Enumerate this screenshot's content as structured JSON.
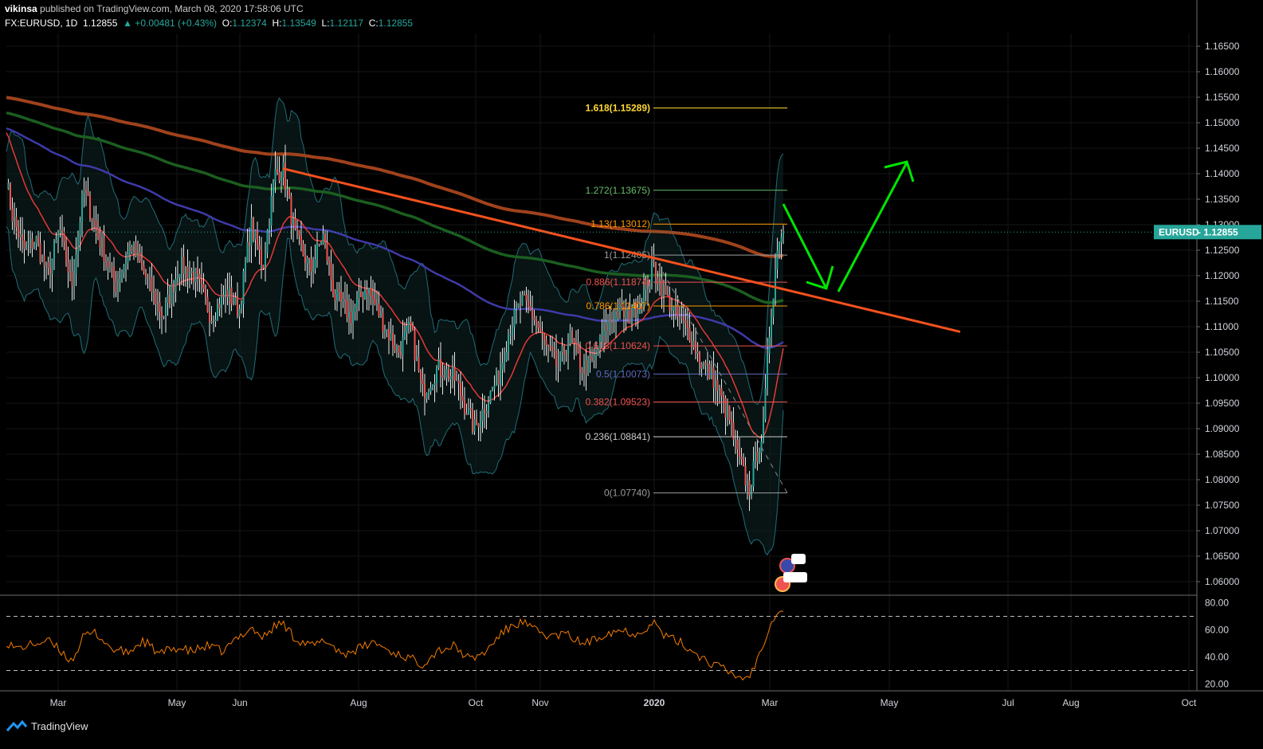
{
  "header": {
    "published_line": {
      "author": "vikinsa",
      "rest": " published on TradingView.com, March 08, 2020 17:58:06 UTC"
    },
    "symbol": "FX:EURUSD, 1D",
    "last": "1.12855",
    "change": "▲ +0.00481 (+0.43%)",
    "open_label": "O:",
    "open": "1.12374",
    "high_label": "H:",
    "high": "1.13549",
    "low_label": "L:",
    "low": "1.12117",
    "close_label": "C:",
    "close": "1.12855"
  },
  "price_tag": {
    "symbol": "EURUSD",
    "value": "1.12855"
  },
  "footer": {
    "brand": "TradingView"
  },
  "colors": {
    "background": "#000000",
    "up_candle": "#26a69a",
    "down_candle": "#ef5350",
    "trendline": "#f4511e",
    "arrow": "#00e600",
    "ema_red": "#e53935",
    "ema_brown": "#a0421c",
    "ema_green": "#1b5e20",
    "ema_blue": "#3f3aa8",
    "bollinger": "#1f6d78",
    "rsi": "#f57c00"
  },
  "chart_data": {
    "type": "candlestick",
    "y_range": [
      1.0575,
      1.1675
    ],
    "y_ticks": [
      "1.06000",
      "1.06500",
      "1.07000",
      "1.07500",
      "1.08000",
      "1.08500",
      "1.09000",
      "1.09500",
      "1.10000",
      "1.10500",
      "1.11000",
      "1.11500",
      "1.12000",
      "1.12500",
      "1.13000",
      "1.13500",
      "1.14000",
      "1.14500",
      "1.15000",
      "1.15500",
      "1.16000",
      "1.16500"
    ],
    "x_ticks": [
      "Mar",
      "May",
      "Jun",
      "Aug",
      "Oct",
      "Nov",
      "2020",
      "Mar",
      "May",
      "Jul",
      "Aug",
      "Oct"
    ],
    "price_path_knots": [
      [
        0,
        1.147
      ],
      [
        15,
        1.132
      ],
      [
        30,
        1.125
      ],
      [
        45,
        1.127
      ],
      [
        60,
        1.12
      ],
      [
        75,
        1.129
      ],
      [
        90,
        1.118
      ],
      [
        105,
        1.137
      ],
      [
        125,
        1.127
      ],
      [
        145,
        1.118
      ],
      [
        165,
        1.126
      ],
      [
        185,
        1.119
      ],
      [
        205,
        1.112
      ],
      [
        225,
        1.122
      ],
      [
        245,
        1.12
      ],
      [
        265,
        1.112
      ],
      [
        285,
        1.117
      ],
      [
        300,
        1.113
      ],
      [
        315,
        1.13
      ],
      [
        330,
        1.122
      ],
      [
        345,
        1.14
      ],
      [
        355,
        1.141
      ],
      [
        370,
        1.128
      ],
      [
        390,
        1.121
      ],
      [
        405,
        1.128
      ],
      [
        420,
        1.116
      ],
      [
        440,
        1.112
      ],
      [
        460,
        1.118
      ],
      [
        480,
        1.111
      ],
      [
        500,
        1.105
      ],
      [
        515,
        1.11
      ],
      [
        530,
        1.097
      ],
      [
        550,
        1.102
      ],
      [
        570,
        1.1
      ],
      [
        595,
        1.09
      ],
      [
        610,
        1.095
      ],
      [
        625,
        1.1
      ],
      [
        640,
        1.11
      ],
      [
        655,
        1.115
      ],
      [
        670,
        1.112
      ],
      [
        685,
        1.106
      ],
      [
        700,
        1.102
      ],
      [
        715,
        1.108
      ],
      [
        730,
        1.102
      ],
      [
        745,
        1.103
      ],
      [
        760,
        1.11
      ],
      [
        775,
        1.113
      ],
      [
        790,
        1.112
      ],
      [
        805,
        1.115
      ],
      [
        820,
        1.122
      ],
      [
        835,
        1.116
      ],
      [
        850,
        1.112
      ],
      [
        865,
        1.109
      ],
      [
        880,
        1.103
      ],
      [
        895,
        1.1
      ],
      [
        905,
        1.096
      ],
      [
        915,
        1.092
      ],
      [
        925,
        1.085
      ],
      [
        940,
        1.078
      ],
      [
        950,
        1.085
      ],
      [
        958,
        1.09
      ],
      [
        965,
        1.108
      ],
      [
        972,
        1.12
      ],
      [
        978,
        1.128
      ],
      [
        983,
        1.1285
      ]
    ],
    "trendline": {
      "from": [
        355,
        1.141
      ],
      "to": [
        1205,
        1.109
      ]
    },
    "fibonacci": [
      {
        "ratio": "0",
        "price": "1.07740",
        "label": "0(1.07740)"
      },
      {
        "ratio": "0.236",
        "price": "1.08841",
        "label": "0.236(1.08841)"
      },
      {
        "ratio": "0.382",
        "price": "1.09523",
        "label": "0.382(1.09523)"
      },
      {
        "ratio": "0.5",
        "price": "1.10073",
        "label": "0.5(1.10073)"
      },
      {
        "ratio": "0.618",
        "price": "1.10624",
        "label": "0.618(1.10624)"
      },
      {
        "ratio": "0.786",
        "price": "1.11407",
        "label": "0.786(1.11407)"
      },
      {
        "ratio": "0.886",
        "price": "1.11874",
        "label": "0.886(1.11874)"
      },
      {
        "ratio": "1",
        "price": "1.12405",
        "label": "1(1.12405)"
      },
      {
        "ratio": "1.13",
        "price": "1.13012",
        "label": "1.13(1.13012)"
      },
      {
        "ratio": "1.272",
        "price": "1.13675",
        "label": "1.272(1.13675)"
      },
      {
        "ratio": "1.618",
        "price": "1.15289",
        "label": "1.618(1.15289)"
      }
    ],
    "rsi": {
      "y_range": [
        15,
        85
      ],
      "y_ticks": [
        "20.00",
        "40.00",
        "60.00",
        "80.00"
      ],
      "levels": [
        70,
        30
      ],
      "knots": [
        [
          0,
          55
        ],
        [
          20,
          46
        ],
        [
          45,
          50
        ],
        [
          60,
          52
        ],
        [
          75,
          45
        ],
        [
          90,
          37
        ],
        [
          105,
          55
        ],
        [
          120,
          58
        ],
        [
          140,
          46
        ],
        [
          160,
          43
        ],
        [
          180,
          52
        ],
        [
          200,
          42
        ],
        [
          220,
          47
        ],
        [
          240,
          44
        ],
        [
          260,
          48
        ],
        [
          280,
          44
        ],
        [
          300,
          55
        ],
        [
          315,
          62
        ],
        [
          330,
          54
        ],
        [
          345,
          63
        ],
        [
          355,
          65
        ],
        [
          370,
          54
        ],
        [
          390,
          48
        ],
        [
          410,
          52
        ],
        [
          430,
          42
        ],
        [
          450,
          46
        ],
        [
          470,
          51
        ],
        [
          490,
          44
        ],
        [
          510,
          40
        ],
        [
          530,
          35
        ],
        [
          550,
          45
        ],
        [
          570,
          48
        ],
        [
          590,
          38
        ],
        [
          610,
          44
        ],
        [
          625,
          55
        ],
        [
          640,
          62
        ],
        [
          655,
          66
        ],
        [
          670,
          60
        ],
        [
          690,
          55
        ],
        [
          710,
          57
        ],
        [
          730,
          50
        ],
        [
          745,
          52
        ],
        [
          760,
          58
        ],
        [
          780,
          60
        ],
        [
          800,
          57
        ],
        [
          820,
          66
        ],
        [
          835,
          55
        ],
        [
          850,
          52
        ],
        [
          870,
          44
        ],
        [
          890,
          36
        ],
        [
          905,
          32
        ],
        [
          920,
          27
        ],
        [
          935,
          24
        ],
        [
          945,
          30
        ],
        [
          955,
          46
        ],
        [
          965,
          62
        ],
        [
          975,
          74
        ],
        [
          983,
          75
        ]
      ]
    }
  }
}
